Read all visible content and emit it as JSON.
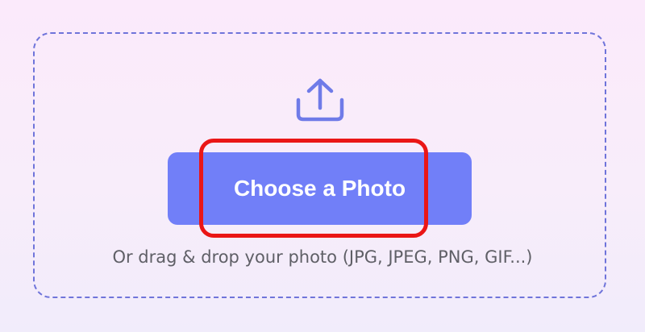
{
  "upload": {
    "icon": "upload-icon",
    "button_label": "Choose a Photo",
    "hint": "Or drag & drop your photo (JPG, JPEG, PNG, GIF...)"
  },
  "colors": {
    "accent": "#717ff8",
    "dropzone_border": "#6f74da",
    "highlight": "#ea1616",
    "hint_text": "#5f5f66"
  }
}
